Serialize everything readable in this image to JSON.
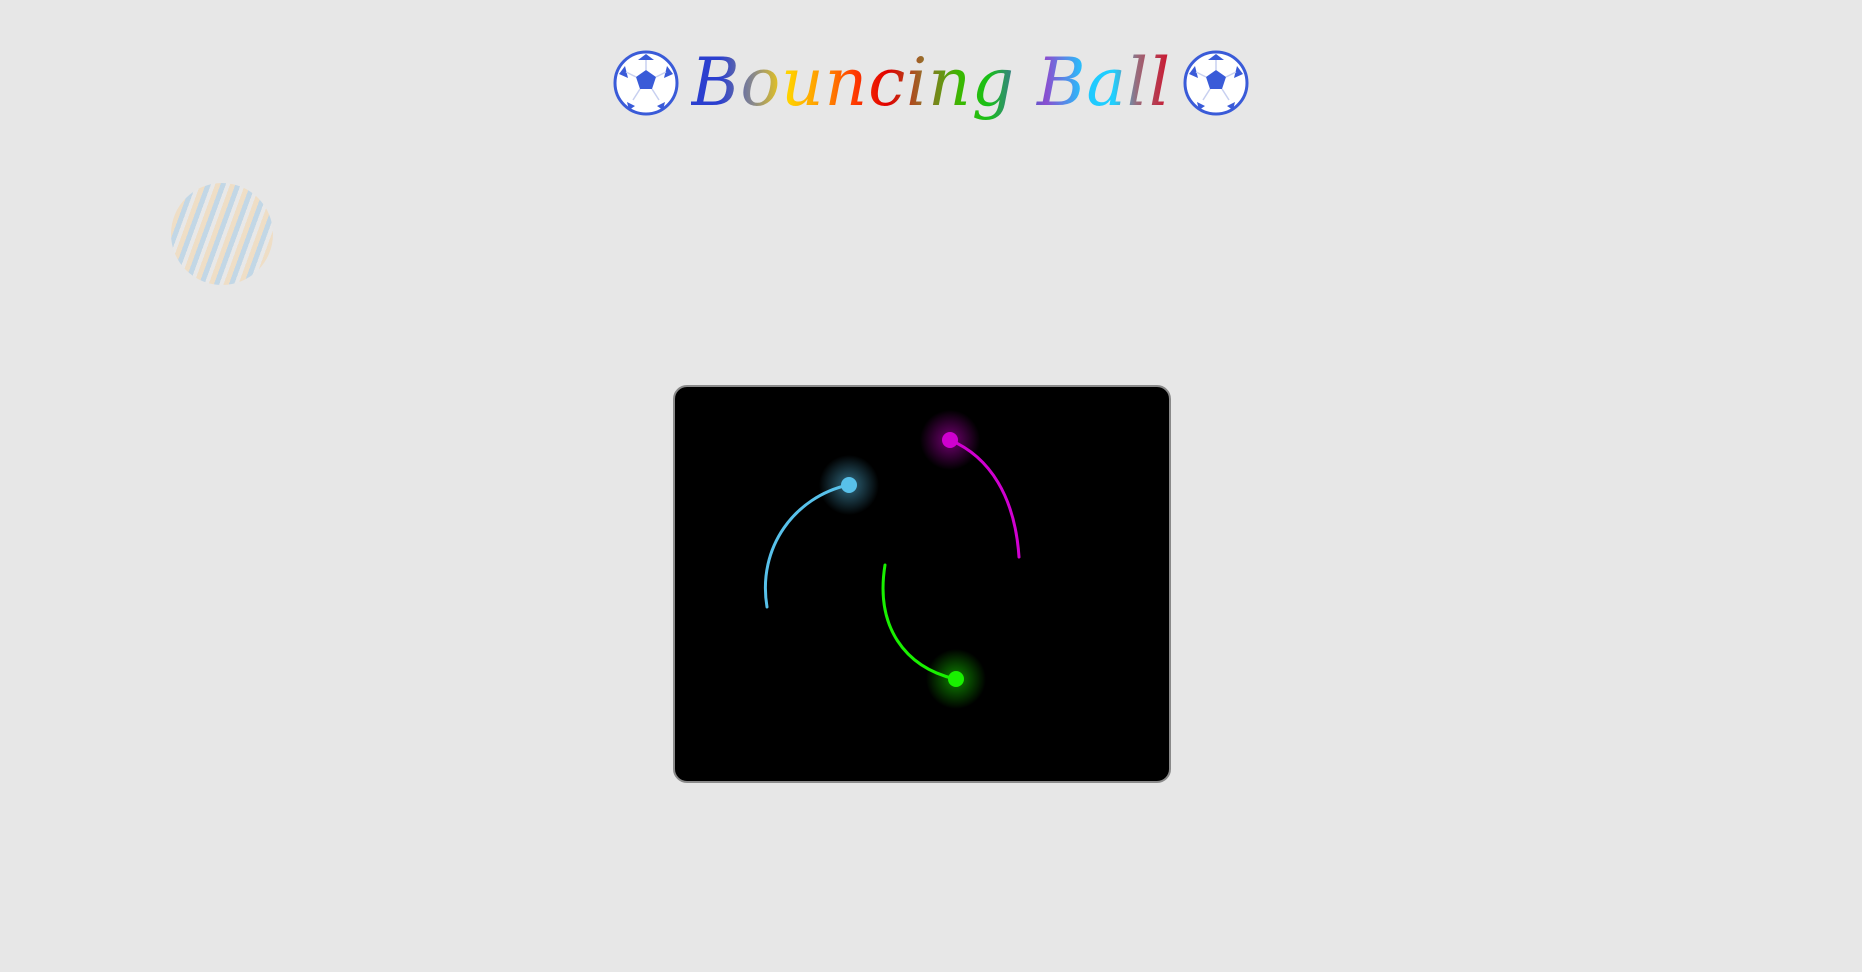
{
  "title": {
    "text": "Bouncing Ball",
    "left_icon": "soccer-ball-icon",
    "right_icon": "soccer-ball-icon"
  },
  "decor": {
    "striped_disc": "striped-disc-icon"
  },
  "game": {
    "background": "#000000",
    "balls": [
      {
        "name": "blue-ball",
        "color": "#58c1ea"
      },
      {
        "name": "magenta-ball",
        "color": "#d000d0"
      },
      {
        "name": "green-ball",
        "color": "#19f000"
      }
    ]
  }
}
